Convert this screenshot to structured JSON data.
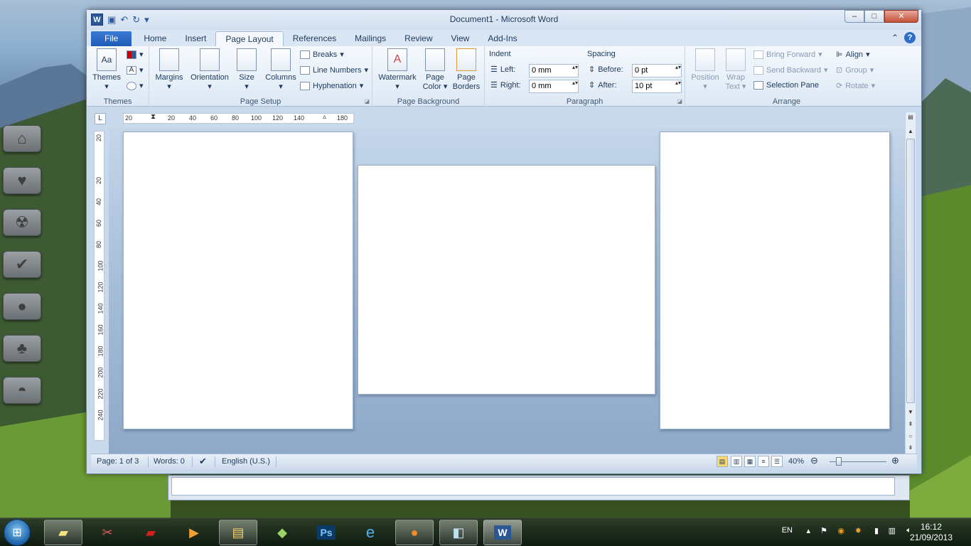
{
  "window": {
    "title": "Document1 - Microsoft Word",
    "logo": "W",
    "controls": [
      "–",
      "□",
      "✕"
    ]
  },
  "tabs": [
    {
      "label": "File"
    },
    {
      "label": "Home"
    },
    {
      "label": "Insert"
    },
    {
      "label": "Page Layout"
    },
    {
      "label": "References"
    },
    {
      "label": "Mailings"
    },
    {
      "label": "Review"
    },
    {
      "label": "View"
    },
    {
      "label": "Add-Ins"
    }
  ],
  "ribbon": {
    "themes": {
      "label": "Themes",
      "group": "Themes"
    },
    "page_setup": {
      "margins": "Margins",
      "orientation": "Orientation",
      "size": "Size",
      "columns": "Columns",
      "breaks": "Breaks",
      "line_numbers": "Line Numbers",
      "hyphenation": "Hyphenation",
      "group": "Page Setup"
    },
    "page_background": {
      "watermark": "Watermark",
      "page_color_1": "Page",
      "page_color_2": "Color",
      "page_borders_1": "Page",
      "page_borders_2": "Borders",
      "group": "Page Background"
    },
    "paragraph": {
      "indent": "Indent",
      "left": "Left:",
      "left_value": "0 mm",
      "right": "Right:",
      "right_value": "0 mm",
      "spacing": "Spacing",
      "before": "Before:",
      "before_value": "0 pt",
      "after": "After:",
      "after_value": "10 pt",
      "group": "Paragraph"
    },
    "arrange": {
      "position": "Position",
      "wrap_1": "Wrap",
      "wrap_2": "Text",
      "bring_forward": "Bring Forward",
      "send_backward": "Send Backward",
      "selection_pane": "Selection Pane",
      "align": "Align",
      "group_btn": "Group",
      "rotate": "Rotate",
      "group": "Arrange"
    }
  },
  "ruler": {
    "h_ticks": [
      "20",
      "20",
      "40",
      "60",
      "80",
      "100",
      "120",
      "140",
      "180"
    ],
    "v_ticks": [
      "20",
      "20",
      "40",
      "60",
      "80",
      "100",
      "120",
      "140",
      "160",
      "180",
      "200",
      "220",
      "240"
    ],
    "tab_marker": "L"
  },
  "status": {
    "page": "Page: 1 of 3",
    "words": "Words: 0",
    "language": "English (U.S.)",
    "zoom": "40%",
    "zoom_level": 0.4
  },
  "taskbar": {
    "lang": "EN",
    "time": "16:12",
    "date": "21/09/2013"
  },
  "colors": {
    "accent": "#2b5797",
    "file_tab": "#1d5bb6"
  }
}
